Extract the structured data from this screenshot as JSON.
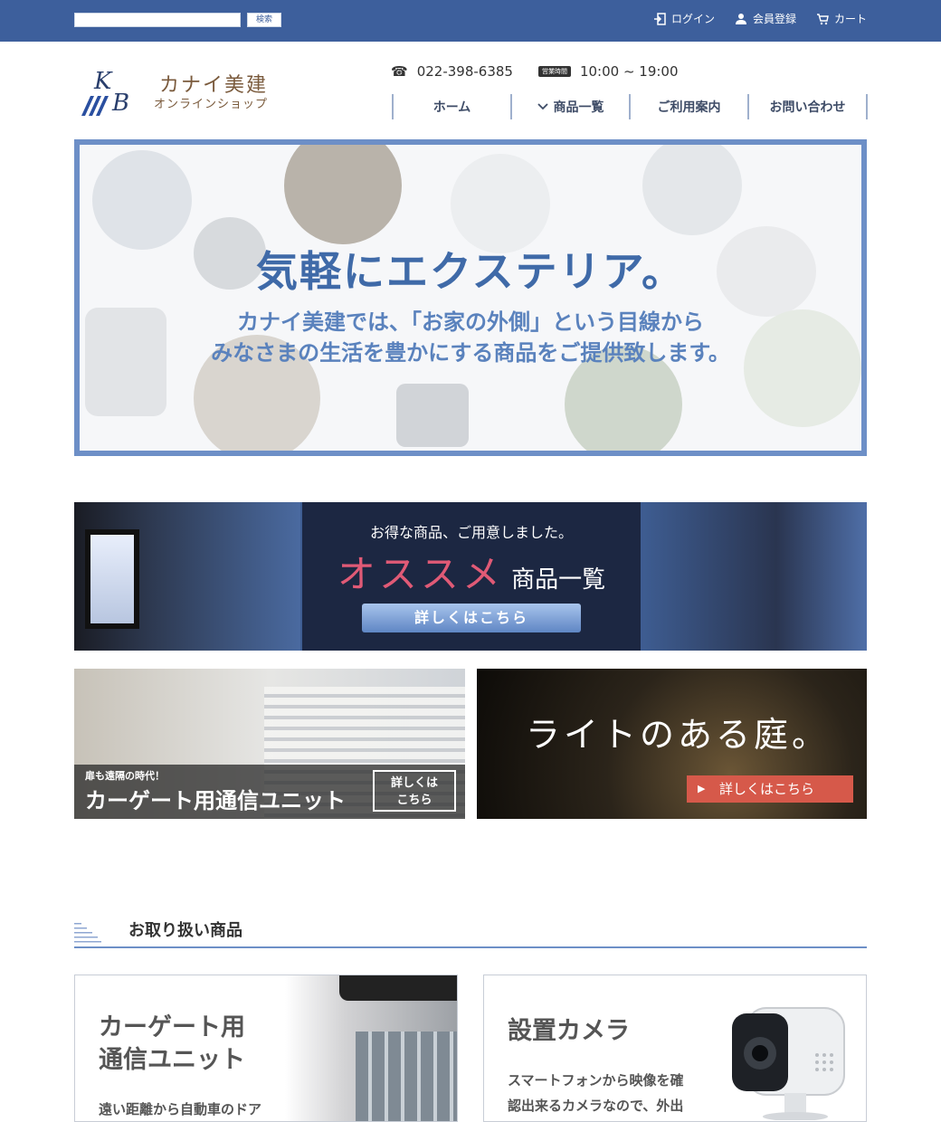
{
  "topbar": {
    "search_placeholder": "",
    "search_button": "検索",
    "links": [
      {
        "label": "ログイン",
        "icon": "login-icon"
      },
      {
        "label": "会員登録",
        "icon": "user-icon"
      },
      {
        "label": "カート",
        "icon": "cart-icon"
      }
    ]
  },
  "header": {
    "logo_mark": "KB",
    "logo_name": "カナイ美建",
    "logo_sub": "オンラインショップ",
    "phone": "022-398-6385",
    "hours_badge": "営業時間",
    "hours": "10:00 ~ 19:00"
  },
  "nav": {
    "items": [
      {
        "label": "ホーム"
      },
      {
        "label": "商品一覧",
        "icon": "chevron-down-icon"
      },
      {
        "label": "ご利用案内"
      },
      {
        "label": "お問い合わせ"
      }
    ]
  },
  "hero": {
    "title": "気軽にエクステリア。",
    "subtitle_line1": "カナイ美建では、「お家の外側」という目線から",
    "subtitle_line2": "みなさまの生活を豊かにする商品をご提供致します。"
  },
  "recommend": {
    "kicker": "お得な商品、ご用意しました。",
    "accent": "オススメ",
    "title_rest": "商品一覧",
    "button": "詳しくはこちら"
  },
  "promo_left": {
    "kicker": "扉も遠隔の時代！",
    "title": "カーゲート用通信ユニット",
    "button_line1": "詳しくは",
    "button_line2": "こちら"
  },
  "promo_right": {
    "title": "ライトのある庭。",
    "button": "詳しくはこちら"
  },
  "section": {
    "title": "お取り扱い商品"
  },
  "products": [
    {
      "title_line1": "カーゲート用",
      "title_line2": "通信ユニット",
      "desc_line1": "遠い距離から自動車のドア"
    },
    {
      "title_line1": "設置カメラ",
      "desc_line1": "スマートフォンから映像を確",
      "desc_line2": "認出来るカメラなので、外出"
    }
  ],
  "colors": {
    "topbar": "#3d5f9c",
    "hero_border": "#6d8fc7",
    "hero_text": "#3f6aa8",
    "accent_pink": "#e05a76",
    "promo_button": "#d6594a"
  }
}
